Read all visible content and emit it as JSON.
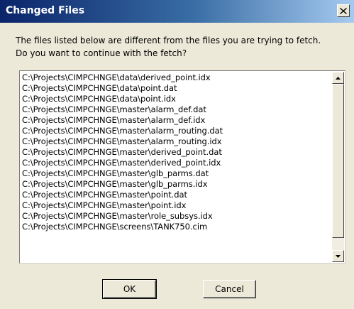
{
  "window": {
    "title": "Changed Files",
    "close_label": "×"
  },
  "message": {
    "line1": "The files listed below are different from the files you are trying to fetch.",
    "line2": "Do you want to continue with the fetch?"
  },
  "files": [
    "C:\\Projects\\CIMPCHNGE\\data\\derived_point.idx",
    "C:\\Projects\\CIMPCHNGE\\data\\point.dat",
    "C:\\Projects\\CIMPCHNGE\\data\\point.idx",
    "C:\\Projects\\CIMPCHNGE\\master\\alarm_def.dat",
    "C:\\Projects\\CIMPCHNGE\\master\\alarm_def.idx",
    "C:\\Projects\\CIMPCHNGE\\master\\alarm_routing.dat",
    "C:\\Projects\\CIMPCHNGE\\master\\alarm_routing.idx",
    "C:\\Projects\\CIMPCHNGE\\master\\derived_point.dat",
    "C:\\Projects\\CIMPCHNGE\\master\\derived_point.idx",
    "C:\\Projects\\CIMPCHNGE\\master\\glb_parms.dat",
    "C:\\Projects\\CIMPCHNGE\\master\\glb_parms.idx",
    "C:\\Projects\\CIMPCHNGE\\master\\point.dat",
    "C:\\Projects\\CIMPCHNGE\\master\\point.idx",
    "C:\\Projects\\CIMPCHNGE\\master\\role_subsys.idx",
    "C:\\Projects\\CIMPCHNGE\\screens\\TANK750.cim"
  ],
  "buttons": {
    "ok_label": "OK",
    "cancel_label": "Cancel"
  },
  "icons": {
    "close": "close-icon",
    "scroll_up": "arrow-up-icon",
    "scroll_down": "arrow-down-icon"
  }
}
